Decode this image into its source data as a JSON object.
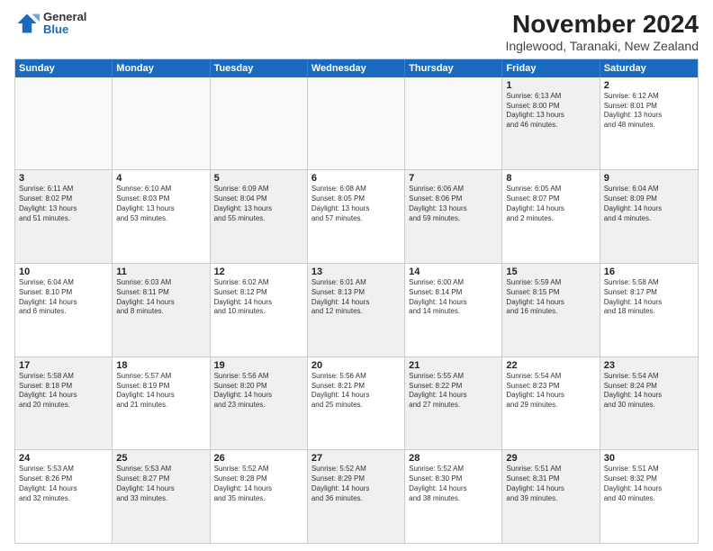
{
  "header": {
    "logo_general": "General",
    "logo_blue": "Blue",
    "title": "November 2024",
    "subtitle": "Inglewood, Taranaki, New Zealand"
  },
  "calendar": {
    "days_of_week": [
      "Sunday",
      "Monday",
      "Tuesday",
      "Wednesday",
      "Thursday",
      "Friday",
      "Saturday"
    ],
    "rows": [
      [
        {
          "day": "",
          "info": "",
          "empty": true
        },
        {
          "day": "",
          "info": "",
          "empty": true
        },
        {
          "day": "",
          "info": "",
          "empty": true
        },
        {
          "day": "",
          "info": "",
          "empty": true
        },
        {
          "day": "",
          "info": "",
          "empty": true
        },
        {
          "day": "1",
          "info": "Sunrise: 6:13 AM\nSunset: 8:00 PM\nDaylight: 13 hours\nand 46 minutes.",
          "shaded": true
        },
        {
          "day": "2",
          "info": "Sunrise: 6:12 AM\nSunset: 8:01 PM\nDaylight: 13 hours\nand 48 minutes.",
          "shaded": false
        }
      ],
      [
        {
          "day": "3",
          "info": "Sunrise: 6:11 AM\nSunset: 8:02 PM\nDaylight: 13 hours\nand 51 minutes.",
          "shaded": true
        },
        {
          "day": "4",
          "info": "Sunrise: 6:10 AM\nSunset: 8:03 PM\nDaylight: 13 hours\nand 53 minutes.",
          "shaded": false
        },
        {
          "day": "5",
          "info": "Sunrise: 6:09 AM\nSunset: 8:04 PM\nDaylight: 13 hours\nand 55 minutes.",
          "shaded": true
        },
        {
          "day": "6",
          "info": "Sunrise: 6:08 AM\nSunset: 8:05 PM\nDaylight: 13 hours\nand 57 minutes.",
          "shaded": false
        },
        {
          "day": "7",
          "info": "Sunrise: 6:06 AM\nSunset: 8:06 PM\nDaylight: 13 hours\nand 59 minutes.",
          "shaded": true
        },
        {
          "day": "8",
          "info": "Sunrise: 6:05 AM\nSunset: 8:07 PM\nDaylight: 14 hours\nand 2 minutes.",
          "shaded": false
        },
        {
          "day": "9",
          "info": "Sunrise: 6:04 AM\nSunset: 8:09 PM\nDaylight: 14 hours\nand 4 minutes.",
          "shaded": true
        }
      ],
      [
        {
          "day": "10",
          "info": "Sunrise: 6:04 AM\nSunset: 8:10 PM\nDaylight: 14 hours\nand 6 minutes.",
          "shaded": false
        },
        {
          "day": "11",
          "info": "Sunrise: 6:03 AM\nSunset: 8:11 PM\nDaylight: 14 hours\nand 8 minutes.",
          "shaded": true
        },
        {
          "day": "12",
          "info": "Sunrise: 6:02 AM\nSunset: 8:12 PM\nDaylight: 14 hours\nand 10 minutes.",
          "shaded": false
        },
        {
          "day": "13",
          "info": "Sunrise: 6:01 AM\nSunset: 8:13 PM\nDaylight: 14 hours\nand 12 minutes.",
          "shaded": true
        },
        {
          "day": "14",
          "info": "Sunrise: 6:00 AM\nSunset: 8:14 PM\nDaylight: 14 hours\nand 14 minutes.",
          "shaded": false
        },
        {
          "day": "15",
          "info": "Sunrise: 5:59 AM\nSunset: 8:15 PM\nDaylight: 14 hours\nand 16 minutes.",
          "shaded": true
        },
        {
          "day": "16",
          "info": "Sunrise: 5:58 AM\nSunset: 8:17 PM\nDaylight: 14 hours\nand 18 minutes.",
          "shaded": false
        }
      ],
      [
        {
          "day": "17",
          "info": "Sunrise: 5:58 AM\nSunset: 8:18 PM\nDaylight: 14 hours\nand 20 minutes.",
          "shaded": true
        },
        {
          "day": "18",
          "info": "Sunrise: 5:57 AM\nSunset: 8:19 PM\nDaylight: 14 hours\nand 21 minutes.",
          "shaded": false
        },
        {
          "day": "19",
          "info": "Sunrise: 5:56 AM\nSunset: 8:20 PM\nDaylight: 14 hours\nand 23 minutes.",
          "shaded": true
        },
        {
          "day": "20",
          "info": "Sunrise: 5:56 AM\nSunset: 8:21 PM\nDaylight: 14 hours\nand 25 minutes.",
          "shaded": false
        },
        {
          "day": "21",
          "info": "Sunrise: 5:55 AM\nSunset: 8:22 PM\nDaylight: 14 hours\nand 27 minutes.",
          "shaded": true
        },
        {
          "day": "22",
          "info": "Sunrise: 5:54 AM\nSunset: 8:23 PM\nDaylight: 14 hours\nand 29 minutes.",
          "shaded": false
        },
        {
          "day": "23",
          "info": "Sunrise: 5:54 AM\nSunset: 8:24 PM\nDaylight: 14 hours\nand 30 minutes.",
          "shaded": true
        }
      ],
      [
        {
          "day": "24",
          "info": "Sunrise: 5:53 AM\nSunset: 8:26 PM\nDaylight: 14 hours\nand 32 minutes.",
          "shaded": false
        },
        {
          "day": "25",
          "info": "Sunrise: 5:53 AM\nSunset: 8:27 PM\nDaylight: 14 hours\nand 33 minutes.",
          "shaded": true
        },
        {
          "day": "26",
          "info": "Sunrise: 5:52 AM\nSunset: 8:28 PM\nDaylight: 14 hours\nand 35 minutes.",
          "shaded": false
        },
        {
          "day": "27",
          "info": "Sunrise: 5:52 AM\nSunset: 8:29 PM\nDaylight: 14 hours\nand 36 minutes.",
          "shaded": true
        },
        {
          "day": "28",
          "info": "Sunrise: 5:52 AM\nSunset: 8:30 PM\nDaylight: 14 hours\nand 38 minutes.",
          "shaded": false
        },
        {
          "day": "29",
          "info": "Sunrise: 5:51 AM\nSunset: 8:31 PM\nDaylight: 14 hours\nand 39 minutes.",
          "shaded": true
        },
        {
          "day": "30",
          "info": "Sunrise: 5:51 AM\nSunset: 8:32 PM\nDaylight: 14 hours\nand 40 minutes.",
          "shaded": false
        }
      ]
    ]
  }
}
